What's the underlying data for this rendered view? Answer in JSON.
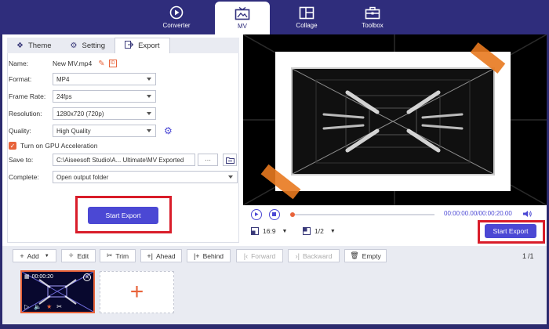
{
  "nav": {
    "tabs": [
      {
        "label": "Converter",
        "icon": "converter-icon"
      },
      {
        "label": "MV",
        "icon": "mv-icon",
        "active": true
      },
      {
        "label": "Collage",
        "icon": "collage-icon"
      },
      {
        "label": "Toolbox",
        "icon": "toolbox-icon"
      }
    ]
  },
  "subtabs": [
    {
      "label": "Theme",
      "icon": "theme-icon"
    },
    {
      "label": "Setting",
      "icon": "gear-icon"
    },
    {
      "label": "Export",
      "icon": "export-icon",
      "active": true
    }
  ],
  "export": {
    "name_label": "Name:",
    "name_value": "New MV.mp4",
    "format_label": "Format:",
    "format_value": "MP4",
    "framerate_label": "Frame Rate:",
    "framerate_value": "24fps",
    "resolution_label": "Resolution:",
    "resolution_value": "1280x720 (720p)",
    "quality_label": "Quality:",
    "quality_value": "High Quality",
    "gpu_label": "Turn on GPU Acceleration",
    "gpu_checked": true,
    "saveto_label": "Save to:",
    "saveto_value": "C:\\Aiseesoft Studio\\A... Ultimate\\MV Exported",
    "saveto_more": "···",
    "complete_label": "Complete:",
    "complete_value": "Open output folder",
    "start_export_label": "Start Export"
  },
  "player": {
    "time_current": "00:00:00.00",
    "time_total": "00:00:20.00",
    "time_separator": "/",
    "aspect_value": "16:9",
    "scale_value": "1/2",
    "start_export_label": "Start Export",
    "progress": 0
  },
  "toolbar": {
    "add": "Add",
    "edit": "Edit",
    "trim": "Trim",
    "ahead": "Ahead",
    "behind": "Behind",
    "forward": "Forward",
    "backward": "Backward",
    "empty": "Empty",
    "page_current": "1",
    "page_total": "/1"
  },
  "timeline": {
    "clip_duration": "00:00:20"
  },
  "colors": {
    "accent": "#4b48d4",
    "nav_bg": "#2f2d7c",
    "highlight": "#d91d2a",
    "orange": "#e8633a"
  }
}
